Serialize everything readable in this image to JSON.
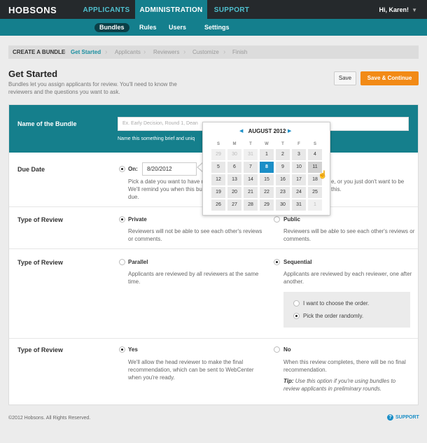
{
  "topbar": {
    "logo": "HOBSONS",
    "nav": [
      {
        "label": "APPLICANTS"
      },
      {
        "label": "ADMINISTRATION"
      },
      {
        "label": "SUPPORT"
      }
    ],
    "user": "Hi, Karen!"
  },
  "subnav": [
    {
      "label": "Bundles"
    },
    {
      "label": "Rules"
    },
    {
      "label": "Users"
    },
    {
      "label": "Settings"
    }
  ],
  "breadcrumb": [
    "CREATE A BUNDLE",
    "Get Started",
    "Applicants",
    "Reviewers",
    "Customize",
    "Finish"
  ],
  "header": {
    "title": "Get Started",
    "description": "Bundles let you assign applicants for review. You'll need to know the reviewers and the questions you want to ask.",
    "save_label": "Save",
    "continue_label": "Save & Continue"
  },
  "bundle_name": {
    "label": "Name of the Bundle",
    "placeholder": "Ex. Early Decision, Round 1, Dean",
    "hint": "Name this something brief and uniq"
  },
  "due_date": {
    "label": "Due Date",
    "on_label": "On:",
    "value": "8/20/2012",
    "desc_left": "Pick a date you want to have r\nWe'll remind you when this bu\ndue.",
    "desc_right": "e, or you just don't want to be\nthis."
  },
  "calendar": {
    "month": "AUGUST 2012",
    "prev": "◀",
    "next": "▶",
    "dow": [
      "S",
      "M",
      "T",
      "W",
      "T",
      "F",
      "S"
    ],
    "weeks": [
      [
        "29",
        "30",
        "31",
        "1",
        "2",
        "3",
        "4"
      ],
      [
        "5",
        "6",
        "7",
        "8",
        "9",
        "10",
        "11"
      ],
      [
        "12",
        "13",
        "14",
        "15",
        "16",
        "17",
        "18"
      ],
      [
        "19",
        "20",
        "21",
        "22",
        "23",
        "24",
        "25"
      ],
      [
        "26",
        "27",
        "28",
        "29",
        "30",
        "31",
        "1"
      ]
    ]
  },
  "review_privacy": {
    "label": "Type of Review",
    "private_label": "Private",
    "private_desc": "Reviewers will not be able to see each other's reviews or comments.",
    "public_label": "Public",
    "public_desc": "Reviewers will be able to see each other's reviews or comments."
  },
  "review_order": {
    "label": "Type of Review",
    "parallel_label": "Parallel",
    "parallel_desc": "Applicants are reviewed by all reviewers at the same time.",
    "sequential_label": "Sequential",
    "sequential_desc": "Applicants are reviewed by each reviewer, one after another.",
    "choose_order": "I want to choose the order.",
    "random_order": "Pick the order randomly."
  },
  "review_final": {
    "label": "Type of Review",
    "yes_label": "Yes",
    "yes_desc": "We'll allow the head reviewer to make the final recommendation, which can be sent to WebCenter when you're ready.",
    "no_label": "No",
    "no_desc": "When this review completes, there will be no final recommendation.",
    "tip_label": "Tip:",
    "tip_text": " Use this option if you're using bundles to review applicants in preliminary rounds."
  },
  "footer": {
    "copyright": "©2012 Hobsons. All Rights Reserved.",
    "support": "SUPPORT"
  }
}
